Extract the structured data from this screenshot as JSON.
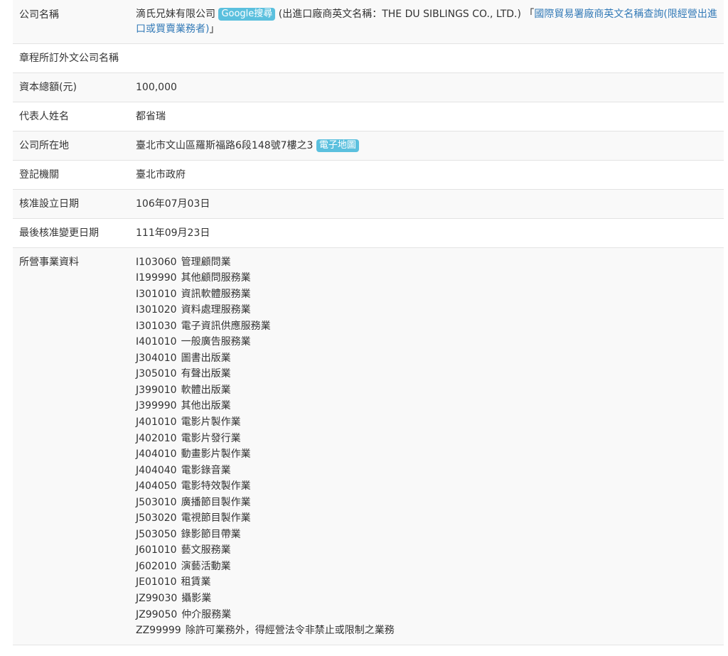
{
  "company_name": {
    "label": "公司名稱",
    "name": "滴氏兄妹有限公司",
    "google_badge": "Google搜尋",
    "en_name_note": "(出進口廠商英文名稱：THE DU SIBLINGS CO., LTD.)",
    "bracket_open": "「",
    "trade_link": "國際貿易署廠商英文名稱查詢(限經營出進口或買賣業務者)",
    "bracket_close": "」"
  },
  "foreign_name": {
    "label": "章程所訂外文公司名稱",
    "value": ""
  },
  "capital": {
    "label": "資本總額(元)",
    "value": "100,000"
  },
  "representative": {
    "label": "代表人姓名",
    "value": "都省瑞"
  },
  "address": {
    "label": "公司所在地",
    "value": "臺北市文山區羅斯福路6段148號7樓之3",
    "map_badge": "電子地圖"
  },
  "registry": {
    "label": "登記機關",
    "value": "臺北市政府"
  },
  "established": {
    "label": "核准設立日期",
    "value": "106年07月03日"
  },
  "last_change": {
    "label": "最後核准變更日期",
    "value": "111年09月23日"
  },
  "business": {
    "label": "所營事業資料",
    "items": [
      {
        "code": "I103060",
        "name": "管理顧問業"
      },
      {
        "code": "I199990",
        "name": "其他顧問服務業"
      },
      {
        "code": "I301010",
        "name": "資訊軟體服務業"
      },
      {
        "code": "I301020",
        "name": "資料處理服務業"
      },
      {
        "code": "I301030",
        "name": "電子資訊供應服務業"
      },
      {
        "code": "I401010",
        "name": "一般廣告服務業"
      },
      {
        "code": "J304010",
        "name": "圖書出版業"
      },
      {
        "code": "J305010",
        "name": "有聲出版業"
      },
      {
        "code": "J399010",
        "name": "軟體出版業"
      },
      {
        "code": "J399990",
        "name": "其他出版業"
      },
      {
        "code": "J401010",
        "name": "電影片製作業"
      },
      {
        "code": "J402010",
        "name": "電影片發行業"
      },
      {
        "code": "J404010",
        "name": "動畫影片製作業"
      },
      {
        "code": "J404040",
        "name": "電影錄音業"
      },
      {
        "code": "J404050",
        "name": "電影特效製作業"
      },
      {
        "code": "J503010",
        "name": "廣播節目製作業"
      },
      {
        "code": "J503020",
        "name": "電視節目製作業"
      },
      {
        "code": "J503050",
        "name": "錄影節目帶業"
      },
      {
        "code": "J601010",
        "name": "藝文服務業"
      },
      {
        "code": "J602010",
        "name": "演藝活動業"
      },
      {
        "code": "JE01010",
        "name": "租賃業"
      },
      {
        "code": "JZ99030",
        "name": "攝影業"
      },
      {
        "code": "JZ99050",
        "name": "仲介服務業"
      },
      {
        "code": "ZZ99999",
        "name": "除許可業務外，得經營法令非禁止或限制之業務"
      }
    ]
  },
  "colors": {
    "badge": "#5bc0de",
    "link": "#337ab7",
    "stripe": "#f9f9f9",
    "border": "#e3e3e3",
    "text": "#333333"
  }
}
